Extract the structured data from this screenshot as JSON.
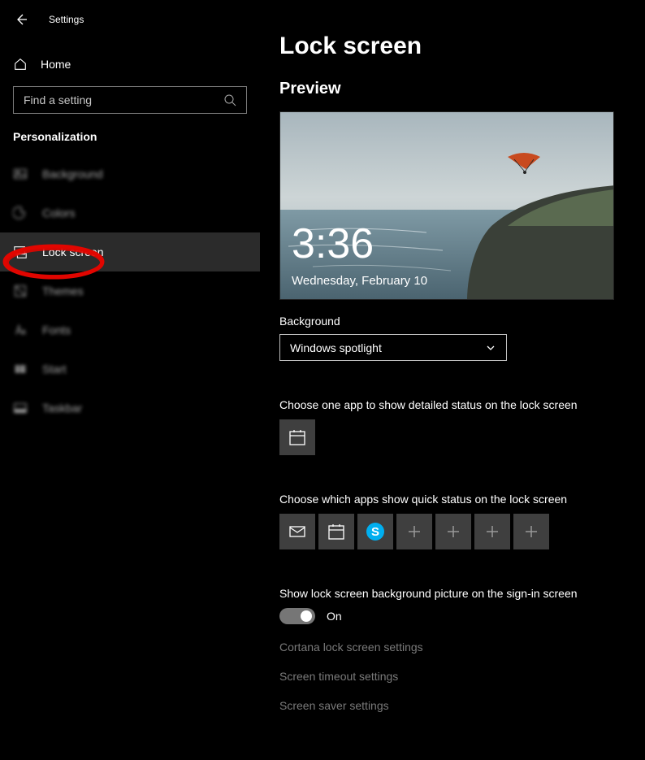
{
  "header": {
    "title": "Settings"
  },
  "sidebar": {
    "home_label": "Home",
    "search_placeholder": "Find a setting",
    "section_title": "Personalization",
    "items": [
      {
        "label": "Background",
        "icon": "picture"
      },
      {
        "label": "Colors",
        "icon": "palette"
      },
      {
        "label": "Lock screen",
        "icon": "lockscreen"
      },
      {
        "label": "Themes",
        "icon": "themes"
      },
      {
        "label": "Fonts",
        "icon": "fonts"
      },
      {
        "label": "Start",
        "icon": "start"
      },
      {
        "label": "Taskbar",
        "icon": "taskbar"
      }
    ]
  },
  "main": {
    "title": "Lock screen",
    "preview_heading": "Preview",
    "preview_time": "3:36",
    "preview_date": "Wednesday, February 10",
    "background_label": "Background",
    "background_value": "Windows spotlight",
    "detailed_label": "Choose one app to show detailed status on the lock screen",
    "detailed_app": "calendar",
    "quick_label": "Choose which apps show quick status on the lock screen",
    "quick_apps": [
      {
        "type": "mail"
      },
      {
        "type": "calendar"
      },
      {
        "type": "skype"
      },
      {
        "type": "add"
      },
      {
        "type": "add"
      },
      {
        "type": "add"
      },
      {
        "type": "add"
      }
    ],
    "signin_bg_label": "Show lock screen background picture on the sign-in screen",
    "signin_toggle_state": "On",
    "links": {
      "cortana": "Cortana lock screen settings",
      "timeout": "Screen timeout settings",
      "saver": "Screen saver settings"
    }
  }
}
